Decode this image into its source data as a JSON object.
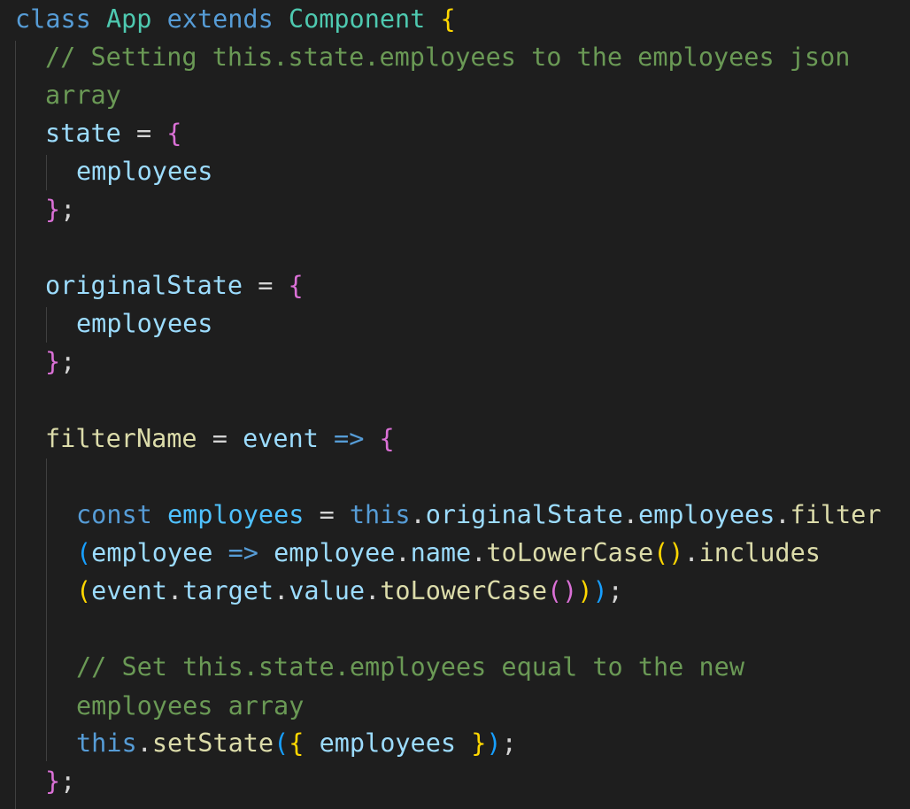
{
  "editor": {
    "theme_colors": {
      "background": "#1e1e1e",
      "keyword": "#569cd6",
      "class_name": "#4ec9b0",
      "variable": "#9cdcfe",
      "function": "#dcdcaa",
      "comment": "#6a9955",
      "bracket_gold": "#ffd700",
      "bracket_purple": "#da70d6",
      "bracket_blue": "#179fff"
    },
    "lines": [
      [
        [
          "class",
          "k-storage"
        ],
        [
          " ",
          "p-plain"
        ],
        [
          "App",
          "t-type"
        ],
        [
          " ",
          "p-plain"
        ],
        [
          "extends",
          "k-storage"
        ],
        [
          " ",
          "p-plain"
        ],
        [
          "Component",
          "t-type"
        ],
        [
          " ",
          "p-plain"
        ],
        [
          "{",
          "b1"
        ]
      ],
      [
        [
          "// Setting this.state.employees to the employees json",
          "c-comment"
        ]
      ],
      [
        [
          "array",
          "c-comment"
        ]
      ],
      [
        [
          "state",
          "v-var"
        ],
        [
          " = ",
          "p-plain"
        ],
        [
          "{",
          "b2"
        ]
      ],
      [
        [
          "employees",
          "v-var"
        ]
      ],
      [
        [
          "}",
          "b2"
        ],
        [
          ";",
          "p-plain"
        ]
      ],
      [],
      [
        [
          "originalState",
          "v-var"
        ],
        [
          " = ",
          "p-plain"
        ],
        [
          "{",
          "b2"
        ]
      ],
      [
        [
          "employees",
          "v-var"
        ]
      ],
      [
        [
          "}",
          "b2"
        ],
        [
          ";",
          "p-plain"
        ]
      ],
      [],
      [
        [
          "filterName",
          "f-fn"
        ],
        [
          " = ",
          "p-plain"
        ],
        [
          "event",
          "v-var"
        ],
        [
          " ",
          "p-plain"
        ],
        [
          "=>",
          "k-storage"
        ],
        [
          " ",
          "p-plain"
        ],
        [
          "{",
          "b2"
        ]
      ],
      [],
      [
        [
          "const",
          "k-storage"
        ],
        [
          " ",
          "p-plain"
        ],
        [
          "employees",
          "v-const"
        ],
        [
          " = ",
          "p-plain"
        ],
        [
          "this",
          "k-storage"
        ],
        [
          ".",
          "p-plain"
        ],
        [
          "originalState",
          "v-var"
        ],
        [
          ".",
          "p-plain"
        ],
        [
          "employees",
          "v-var"
        ],
        [
          ".",
          "p-plain"
        ],
        [
          "filter",
          "f-fn"
        ]
      ],
      [
        [
          "(",
          "b3"
        ],
        [
          "employee",
          "v-var"
        ],
        [
          " ",
          "p-plain"
        ],
        [
          "=>",
          "k-storage"
        ],
        [
          " ",
          "p-plain"
        ],
        [
          "employee",
          "v-var"
        ],
        [
          ".",
          "p-plain"
        ],
        [
          "name",
          "v-var"
        ],
        [
          ".",
          "p-plain"
        ],
        [
          "toLowerCase",
          "f-fn"
        ],
        [
          "()",
          "b1"
        ],
        [
          ".",
          "p-plain"
        ],
        [
          "includes",
          "f-fn"
        ]
      ],
      [
        [
          "(",
          "b1"
        ],
        [
          "event",
          "v-var"
        ],
        [
          ".",
          "p-plain"
        ],
        [
          "target",
          "v-var"
        ],
        [
          ".",
          "p-plain"
        ],
        [
          "value",
          "v-var"
        ],
        [
          ".",
          "p-plain"
        ],
        [
          "toLowerCase",
          "f-fn"
        ],
        [
          "()",
          "b2"
        ],
        [
          ")",
          "b1"
        ],
        [
          ")",
          "b3"
        ],
        [
          ";",
          "p-plain"
        ]
      ],
      [],
      [
        [
          "// Set this.state.employees equal to the new",
          "c-comment"
        ]
      ],
      [
        [
          "employees array",
          "c-comment"
        ]
      ],
      [
        [
          "this",
          "k-storage"
        ],
        [
          ".",
          "p-plain"
        ],
        [
          "setState",
          "f-fn"
        ],
        [
          "(",
          "b3"
        ],
        [
          "{",
          "b1"
        ],
        [
          " ",
          "p-plain"
        ],
        [
          "employees",
          "v-var"
        ],
        [
          " ",
          "p-plain"
        ],
        [
          "}",
          "b1"
        ],
        [
          ")",
          "b3"
        ],
        [
          ";",
          "p-plain"
        ]
      ],
      [
        [
          "}",
          "b2"
        ],
        [
          ";",
          "p-plain"
        ]
      ]
    ]
  }
}
